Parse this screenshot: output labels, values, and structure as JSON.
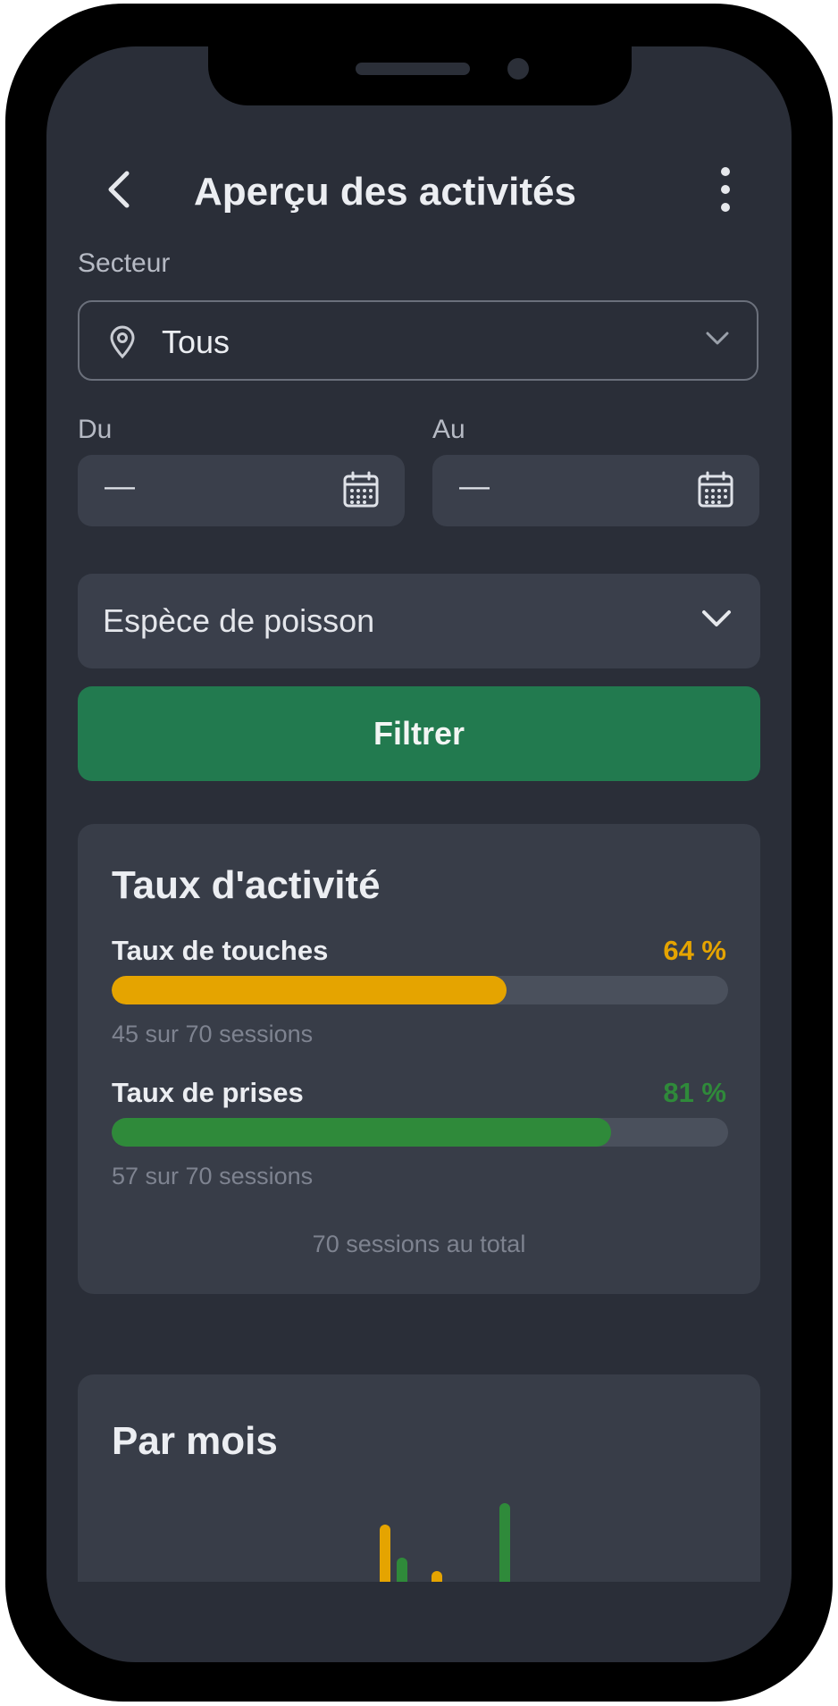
{
  "header": {
    "title": "Aperçu des activités"
  },
  "filters": {
    "sector_label": "Secteur",
    "sector_value": "Tous",
    "from_label": "Du",
    "from_value": "—",
    "to_label": "Au",
    "to_value": "—",
    "species_placeholder": "Espèce de poisson",
    "filter_button": "Filtrer"
  },
  "activity": {
    "title": "Taux d'activité",
    "metrics": [
      {
        "name": "Taux de touches",
        "percent_text": "64 %",
        "fraction": 0.64,
        "sessions_text": "45 sur 70 sessions",
        "color": "#e5a400"
      },
      {
        "name": "Taux de prises",
        "percent_text": "81 %",
        "fraction": 0.81,
        "sessions_text": "57 sur 70 sessions",
        "color": "#2f8a3a"
      }
    ],
    "total_text": "70 sessions au total"
  },
  "monthly": {
    "title": "Par mois"
  },
  "colors": {
    "touches": "#e5a400",
    "prises": "#2f8a3a",
    "filter_button": "#227a4f"
  }
}
